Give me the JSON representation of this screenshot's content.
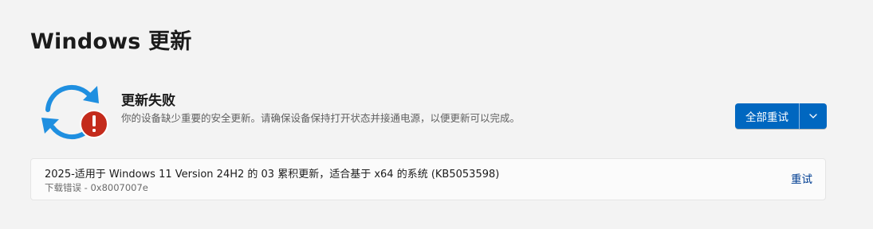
{
  "page": {
    "title": "Windows 更新"
  },
  "status": {
    "heading": "更新失败",
    "description": "你的设备缺少重要的安全更新。请确保设备保持打开状态并接通电源，以便更新可以完成。",
    "icon": "sync-error-icon"
  },
  "actions": {
    "retry_all_label": "全部重试",
    "dropdown_icon": "chevron-down-icon"
  },
  "update_item": {
    "name": "2025-适用于 Windows 11 Version 24H2 的 03 累积更新，适合基于 x64 的系统 (KB5053598)",
    "error": "下载错误 - 0x8007007e",
    "retry_label": "重试"
  },
  "colors": {
    "accent": "#0067c0",
    "sync_blue": "#1f8fe0",
    "error_red": "#c42b1c",
    "link": "#003e92",
    "background": "#f3f3f3"
  }
}
